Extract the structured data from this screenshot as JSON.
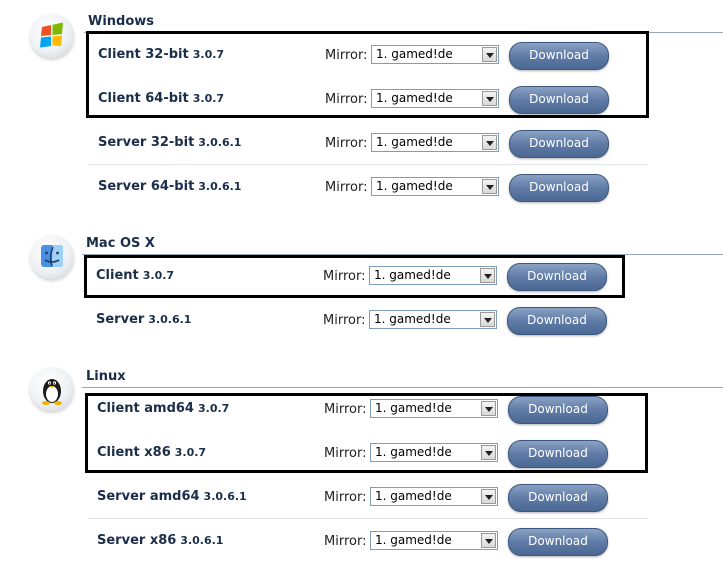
{
  "sections": [
    {
      "title": "Windows",
      "icon": "windows-logo-icon",
      "rows": [
        {
          "name": "Client 32-bit",
          "version": "3.0.7"
        },
        {
          "name": "Client 64-bit",
          "version": "3.0.7"
        },
        {
          "name": "Server 32-bit",
          "version": "3.0.6.1"
        },
        {
          "name": "Server 64-bit",
          "version": "3.0.6.1"
        }
      ]
    },
    {
      "title": "Mac OS X",
      "icon": "mac-finder-icon",
      "rows": [
        {
          "name": "Client",
          "version": "3.0.7"
        },
        {
          "name": "Server",
          "version": "3.0.6.1"
        }
      ]
    },
    {
      "title": "Linux",
      "icon": "linux-tux-icon",
      "rows": [
        {
          "name": "Client amd64",
          "version": "3.0.7"
        },
        {
          "name": "Client x86",
          "version": "3.0.7"
        },
        {
          "name": "Server amd64",
          "version": "3.0.6.1"
        },
        {
          "name": "Server x86",
          "version": "3.0.6.1"
        }
      ]
    }
  ],
  "mirror_label": "Mirror:",
  "mirror_selected": "1. gamed!de",
  "download_label": "Download"
}
